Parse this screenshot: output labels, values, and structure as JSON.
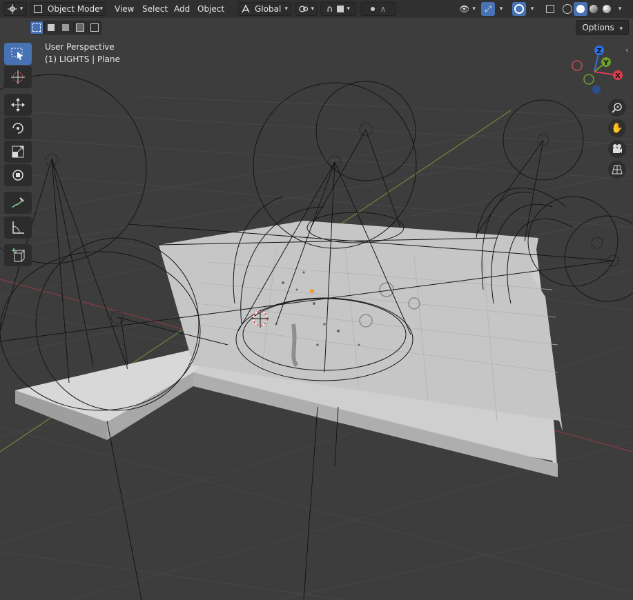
{
  "header": {
    "mode_label": "Object Mode",
    "menus": [
      "View",
      "Select",
      "Add",
      "Object"
    ],
    "transform_orientation": "Global",
    "options_label": "Options"
  },
  "viewport": {
    "view_name": "User Perspective",
    "active_object": "(1) LIGHTS | Plane"
  },
  "gizmo": {
    "axes": [
      {
        "label": "Z",
        "color": "#2f6fe4"
      },
      {
        "label": "Y",
        "color": "#6aa02b"
      },
      {
        "label": "X",
        "color": "#e03c4b"
      }
    ]
  },
  "toolbar": {
    "tools": [
      "select-box",
      "cursor",
      "move",
      "rotate",
      "scale",
      "transform",
      "annotate",
      "measure",
      "add-cube"
    ],
    "active_tool": "select-box"
  },
  "shading": {
    "active_mode": "solid"
  },
  "colors": {
    "accent": "#4772b3",
    "header_bg": "#303030",
    "viewport_bg": "#3d3d3d"
  }
}
